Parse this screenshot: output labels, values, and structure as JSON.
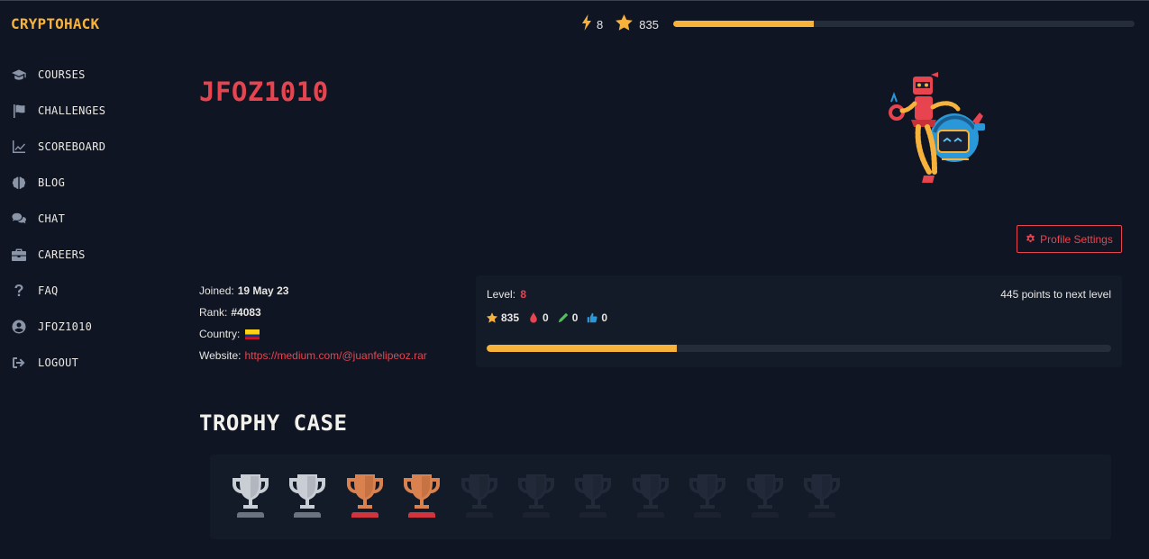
{
  "app": {
    "logo": "CRYPTOHACK"
  },
  "sidebar": {
    "items": [
      {
        "label": "COURSES",
        "icon": "graduation-cap-icon"
      },
      {
        "label": "CHALLENGES",
        "icon": "flag-icon"
      },
      {
        "label": "SCOREBOARD",
        "icon": "chart-line-icon"
      },
      {
        "label": "BLOG",
        "icon": "brain-icon"
      },
      {
        "label": "CHAT",
        "icon": "comments-icon"
      },
      {
        "label": "CAREERS",
        "icon": "briefcase-icon"
      },
      {
        "label": "FAQ",
        "icon": "question-icon"
      },
      {
        "label": "JFOZ1010",
        "icon": "user-circle-icon"
      },
      {
        "label": "LOGOUT",
        "icon": "sign-out-icon"
      }
    ]
  },
  "topbar": {
    "level": "8",
    "points": "835",
    "progress": 0.305,
    "accent": "#f7b23b"
  },
  "profile": {
    "username": "JFOZ1010",
    "settings_label": "Profile Settings",
    "joined_label": "Joined:",
    "joined": "19 May 23",
    "rank_label": "Rank:",
    "rank": "#4083",
    "country_label": "Country:",
    "country_flag": "colombia-flag",
    "website_label": "Website:",
    "website": "https://medium.com/@juanfelipeoz.rar"
  },
  "level_card": {
    "level_label": "Level:",
    "level": "8",
    "next_level": "445 points to next level",
    "points": "835",
    "first_bloods": "0",
    "solutions": "0",
    "likes": "0",
    "progress": 0.305
  },
  "trophy_case": {
    "title": "TROPHY CASE",
    "trophies": [
      "silver",
      "silver",
      "bronze",
      "bronze",
      "locked",
      "locked",
      "locked",
      "locked",
      "locked",
      "locked",
      "locked"
    ]
  },
  "colors": {
    "background": "#0f1522",
    "card": "#141b28",
    "accent_red": "#e8444f",
    "accent_gold": "#f7b23b"
  }
}
